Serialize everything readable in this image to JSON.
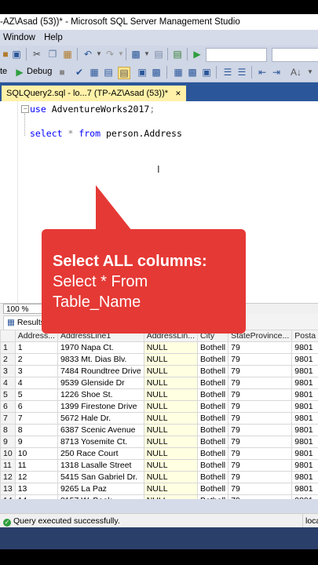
{
  "window": {
    "title": "-AZ\\Asad (53))* - Microsoft SQL Server Management Studio"
  },
  "menu": [
    "Window",
    "Help"
  ],
  "toolbar": {
    "execute_label": "te",
    "debug_label": "Debug"
  },
  "editor_tab": {
    "label": "SQLQuery2.sql - lo...7 (TP-AZ\\Asad (53))*",
    "close": "✕"
  },
  "code": {
    "line1_keyword": "use",
    "line1_rest": " AdventureWorks2017",
    "line1_end": ";",
    "line2_keyword": "select",
    "line2_star": " * ",
    "line2_from": "from",
    "line2_rest": " person.Address"
  },
  "zoom": "100 %",
  "results": {
    "tab_label": "Results",
    "columns": [
      "Address...",
      "AddressLine1",
      "AddressLin...",
      "City",
      "StateProvince...",
      "Posta"
    ],
    "rows": [
      [
        "1",
        "1",
        "1970 Napa Ct.",
        "NULL",
        "Bothell",
        "79",
        "9801"
      ],
      [
        "2",
        "2",
        "9833 Mt. Dias Blv.",
        "NULL",
        "Bothell",
        "79",
        "9801"
      ],
      [
        "3",
        "3",
        "7484 Roundtree Drive",
        "NULL",
        "Bothell",
        "79",
        "9801"
      ],
      [
        "4",
        "4",
        "9539 Glenside Dr",
        "NULL",
        "Bothell",
        "79",
        "9801"
      ],
      [
        "5",
        "5",
        "1226 Shoe St.",
        "NULL",
        "Bothell",
        "79",
        "9801"
      ],
      [
        "6",
        "6",
        "1399 Firestone Drive",
        "NULL",
        "Bothell",
        "79",
        "9801"
      ],
      [
        "7",
        "7",
        "5672 Hale Dr.",
        "NULL",
        "Bothell",
        "79",
        "9801"
      ],
      [
        "8",
        "8",
        "6387 Scenic Avenue",
        "NULL",
        "Bothell",
        "79",
        "9801"
      ],
      [
        "9",
        "9",
        "8713 Yosemite Ct.",
        "NULL",
        "Bothell",
        "79",
        "9801"
      ],
      [
        "10",
        "10",
        "250 Race Court",
        "NULL",
        "Bothell",
        "79",
        "9801"
      ],
      [
        "11",
        "11",
        "1318 Lasalle Street",
        "NULL",
        "Bothell",
        "79",
        "9801"
      ],
      [
        "12",
        "12",
        "5415 San Gabriel Dr.",
        "NULL",
        "Bothell",
        "79",
        "9801"
      ],
      [
        "13",
        "13",
        "9265 La Paz",
        "NULL",
        "Bothell",
        "79",
        "9801"
      ],
      [
        "14",
        "14",
        "8157 W. Book",
        "NULL",
        "Bothell",
        "79",
        "9801"
      ]
    ]
  },
  "status": {
    "message": "Query executed successfully.",
    "right": "loca"
  },
  "callout": {
    "heading": "Select ALL columns:",
    "line2": "Select * From",
    "line3": "Table_Name",
    "color": "#e53935"
  }
}
